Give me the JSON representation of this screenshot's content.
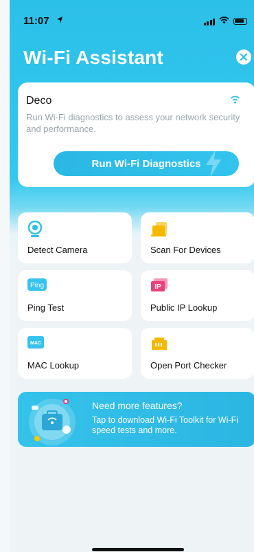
{
  "status_bar": {
    "time": "11:07"
  },
  "header": {
    "title": "Wi-Fi Assistant"
  },
  "network_card": {
    "name": "Deco",
    "description": "Run Wi-Fi diagnostics to assess your network security and performance.",
    "button_label": "Run Wi-Fi Diagnostics"
  },
  "tools": [
    {
      "label": "Detect Camera",
      "icon": "camera-icon"
    },
    {
      "label": "Scan For Devices",
      "icon": "devices-icon"
    },
    {
      "label": "Ping Test",
      "icon": "ping-icon",
      "icon_text": "Ping"
    },
    {
      "label": "Public IP Lookup",
      "icon": "ip-icon",
      "icon_text": "IP"
    },
    {
      "label": "MAC Lookup",
      "icon": "mac-icon",
      "icon_text": "MAC"
    },
    {
      "label": "Open Port Checker",
      "icon": "port-icon"
    }
  ],
  "promo": {
    "title": "Need more features?",
    "body": "Tap to download Wi-Fi Toolkit for Wi-Fi speed tests and more."
  },
  "colors": {
    "accent": "#2bc0e8",
    "orange": "#f5b800"
  }
}
